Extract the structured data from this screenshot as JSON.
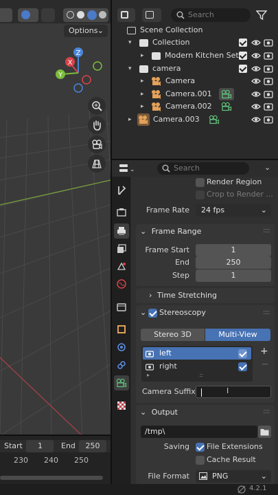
{
  "viewport": {
    "options_label": "Options",
    "gizmo": {
      "z": "Z",
      "x": "X",
      "y": "Y"
    }
  },
  "timeline": {
    "start_label": "Start",
    "start_value": "1",
    "end_label": "End",
    "end_value": "250",
    "ticks": [
      "230",
      "240",
      "250"
    ]
  },
  "outliner": {
    "search_placeholder": "Search",
    "rows": [
      {
        "label": "Scene Collection",
        "icon": "scene-collection-icon"
      },
      {
        "label": "Collection",
        "icon": "collection-icon"
      },
      {
        "label": "Modern Kitchen Set",
        "icon": "collection-icon"
      },
      {
        "label": "camera",
        "icon": "collection-icon"
      },
      {
        "label": "Camera",
        "icon": "camera-object-icon"
      },
      {
        "label": "Camera.001",
        "icon": "camera-object-icon"
      },
      {
        "label": "Camera.002",
        "icon": "camera-object-icon"
      },
      {
        "label": "Camera.003",
        "icon": "camera-object-icon"
      }
    ]
  },
  "properties": {
    "search_placeholder": "Search",
    "render_region": "Render Region",
    "crop_to_render": "Crop to Render ...",
    "frame_rate_label": "Frame Rate",
    "frame_rate_value": "24 fps",
    "frame_range_title": "Frame Range",
    "frame_start_label": "Frame Start",
    "frame_start_value": "1",
    "end_label": "End",
    "end_value": "250",
    "step_label": "Step",
    "step_value": "1",
    "time_stretching_title": "Time Stretching",
    "stereoscopy_title": "Stereoscopy",
    "stereo_3d_label": "Stereo 3D",
    "multi_view_label": "Multi-View",
    "views": [
      "left",
      "right"
    ],
    "camera_suffix_label": "Camera Suffix",
    "camera_suffix_value": "",
    "output_title": "Output",
    "output_path": "/tmp\\",
    "saving_label": "Saving",
    "file_extensions_label": "File Extensions",
    "cache_result_label": "Cache Result",
    "file_format_label": "File Format",
    "file_format_value": "PNG"
  },
  "status": {
    "version": "4.2.1"
  },
  "colors": {
    "accent_blue": "#4772b3",
    "camera_orange": "#e3a15a",
    "camera_green": "#5fc07a"
  }
}
